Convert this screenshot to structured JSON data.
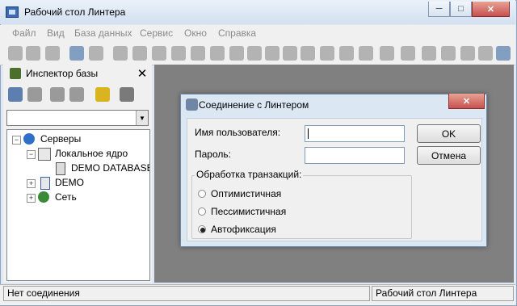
{
  "window": {
    "title": "Рабочий стол Линтера"
  },
  "menu": [
    "Файл",
    "Вид",
    "База данных",
    "Сервис",
    "Окно",
    "Справка"
  ],
  "panel": {
    "title": "Инспектор базы"
  },
  "tree": {
    "servers": "Серверы",
    "local_core": "Локальное ядро",
    "db": "DEMO DATABASE",
    "demo": "DEMO",
    "network": "Сеть"
  },
  "dialog": {
    "title": "Соединение с Линтером",
    "user_label": "Имя пользователя:",
    "user_value": "",
    "password_label": "Пароль:",
    "password_value": "",
    "ok_label": "OK",
    "cancel_label": "Отмена",
    "group_label": "Обработка транзакций:",
    "options": [
      "Оптимистичная",
      "Пессимистичная",
      "Автофиксация"
    ],
    "selected_option": "Автофиксация"
  },
  "status": {
    "left": "Нет соединения",
    "right": "Рабочий стол Линтера"
  }
}
